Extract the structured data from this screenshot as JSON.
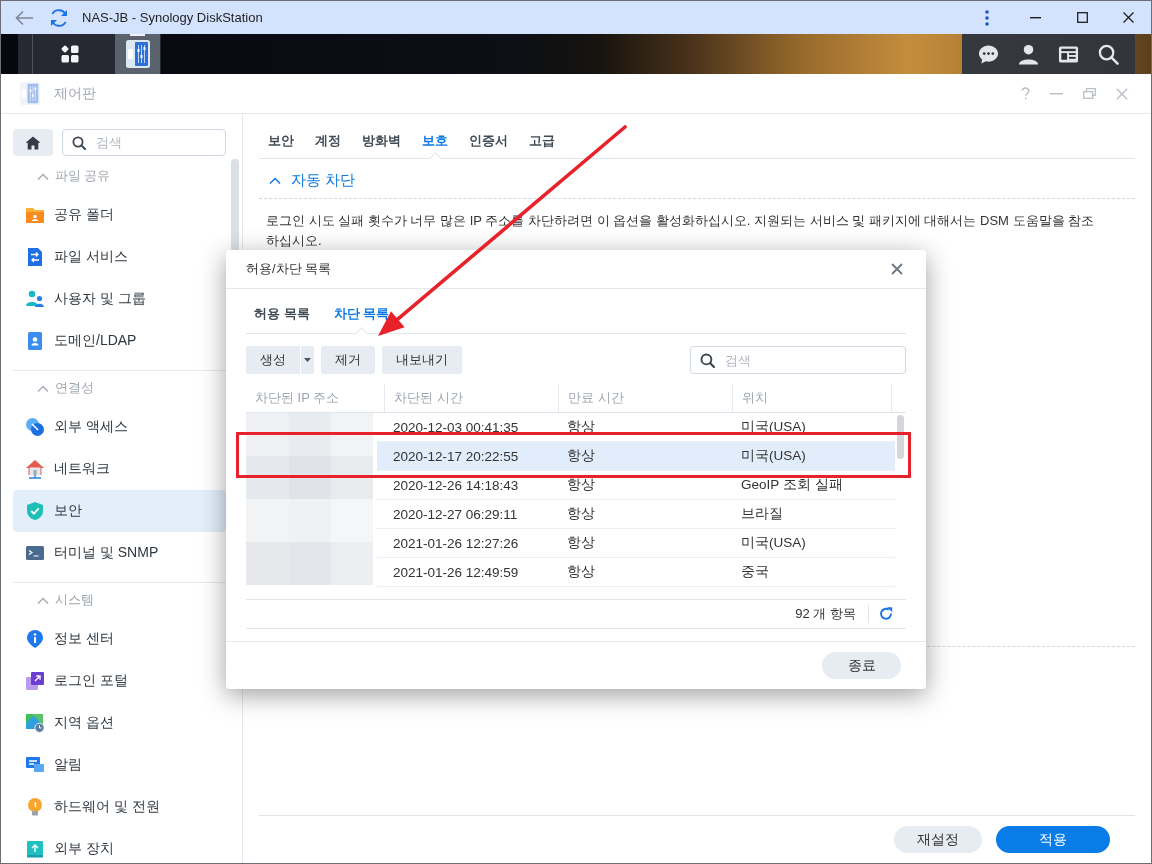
{
  "browser": {
    "title": "NAS-JB - Synology DiskStation"
  },
  "taskbar": {
    "apps": [
      {
        "kind": "main-menu",
        "selected": false
      },
      {
        "kind": "control-panel",
        "selected": true
      }
    ]
  },
  "window": {
    "title": "제어판",
    "active": false
  },
  "sidebar": {
    "search": {
      "placeholder": "검색"
    },
    "sections": [
      {
        "title": "파일 공유",
        "expanded": true,
        "items": [
          {
            "label": "공유 폴더",
            "kind": "shared-folder",
            "selected": false
          },
          {
            "label": "파일 서비스",
            "kind": "file-services",
            "selected": false
          },
          {
            "label": "사용자 및 그룹",
            "kind": "users",
            "selected": false
          },
          {
            "label": "도메인/LDAP",
            "kind": "domain",
            "selected": false
          }
        ]
      },
      {
        "title": "연결성",
        "expanded": true,
        "items": [
          {
            "label": "외부 액세스",
            "kind": "external-access",
            "selected": false
          },
          {
            "label": "네트워크",
            "kind": "network",
            "selected": false
          },
          {
            "label": "보안",
            "kind": "security",
            "selected": true
          },
          {
            "label": "터미널 및 SNMP",
            "kind": "terminal",
            "selected": false
          }
        ]
      },
      {
        "title": "시스템",
        "expanded": true,
        "items": [
          {
            "label": "정보 센터",
            "kind": "info",
            "selected": false
          },
          {
            "label": "로그인 포털",
            "kind": "login-portal",
            "selected": false
          },
          {
            "label": "지역 옵션",
            "kind": "regional",
            "selected": false
          },
          {
            "label": "알림",
            "kind": "notification",
            "selected": false
          },
          {
            "label": "하드웨어 및 전원",
            "kind": "hardware",
            "selected": false
          },
          {
            "label": "외부 장치",
            "kind": "external-devices",
            "selected": false
          }
        ]
      }
    ]
  },
  "tabs": [
    {
      "label": "보안",
      "selected": false
    },
    {
      "label": "계정",
      "selected": false
    },
    {
      "label": "방화벽",
      "selected": false
    },
    {
      "label": "보호",
      "selected": true
    },
    {
      "label": "인증서",
      "selected": false
    },
    {
      "label": "고급",
      "selected": false
    }
  ],
  "section": {
    "title": "자동 차단",
    "expanded": true,
    "description": "로그인 시도 실패 횟수가 너무 많은 IP 주소를 차단하려면 이 옵션을 활성화하십시오. 지원되는 서비스 및 패키지에 대해서는 DSM 도움말을 참조하십시오."
  },
  "buttons": [
    {
      "label": "재설정",
      "kind": "secondary"
    },
    {
      "label": "적용",
      "kind": "primary"
    }
  ],
  "dialog": {
    "title": "허용/차단 목록",
    "tabs": [
      {
        "label": "허용 목록",
        "selected": false
      },
      {
        "label": "차단 목록",
        "selected": true
      }
    ],
    "toolbar": {
      "buttons": [
        {
          "label": "생성",
          "kind": "split"
        },
        {
          "label": "제거",
          "kind": "plain"
        },
        {
          "label": "내보내기",
          "kind": "plain"
        }
      ],
      "search": {
        "placeholder": "검색"
      }
    },
    "table": {
      "columns": [
        "차단된 IP 주소",
        "차단된 시간",
        "만료 시간",
        "위치"
      ],
      "rows": [
        {
          "blocked_time": "2020-12-03 00:41:35",
          "expires": "항상",
          "location": "미국(USA)",
          "selected": false
        },
        {
          "blocked_time": "2020-12-17 20:22:55",
          "expires": "항상",
          "location": "미국(USA)",
          "selected": true
        },
        {
          "blocked_time": "2020-12-26 14:18:43",
          "expires": "항상",
          "location": "GeoIP 조회 실패",
          "selected": false
        },
        {
          "blocked_time": "2020-12-27 06:29:11",
          "expires": "항상",
          "location": "브라질",
          "selected": false
        },
        {
          "blocked_time": "2021-01-26 12:27:26",
          "expires": "항상",
          "location": "미국(USA)",
          "selected": false
        },
        {
          "blocked_time": "2021-01-26 12:49:59",
          "expires": "항상",
          "location": "중국",
          "selected": false
        }
      ]
    },
    "count": "92 개 항목",
    "buttons": [
      {
        "label": "종료",
        "kind": "secondary"
      }
    ]
  }
}
